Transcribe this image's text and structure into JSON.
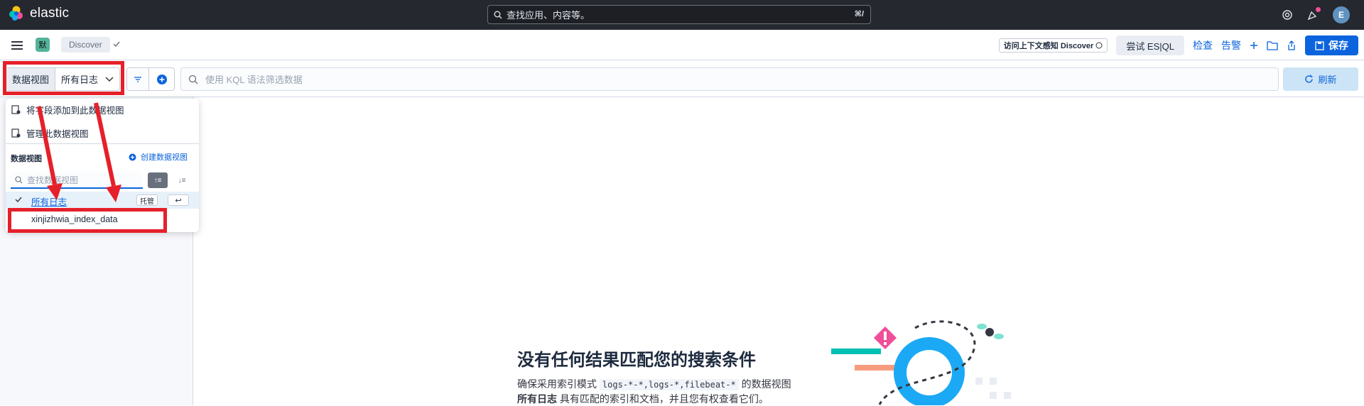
{
  "topbar": {
    "brand": "elastic",
    "search_placeholder": "查找应用、内容等。",
    "search_shortcut": "⌘/",
    "avatar_initial": "E"
  },
  "header": {
    "space_initial": "默",
    "breadcrumb": "Discover",
    "context_badge": "访问上下文感知 Discover",
    "esql_button": "尝试 ES|QL",
    "inspect_link": "检查",
    "alerts_link": "告警",
    "save_button": "保存"
  },
  "querybar": {
    "dataview_label": "数据视图",
    "dataview_selected": "所有日志",
    "kql_placeholder": "使用 KQL 语法筛选数据",
    "refresh_button": "刷新"
  },
  "popover": {
    "action_add_field": "将字段添加到此数据视图",
    "action_manage": "管理此数据视图",
    "section_title": "数据视图",
    "create_link": "创建数据视图",
    "search_placeholder": "查找数据视图",
    "sort_asc_label": "↑≡",
    "sort_desc_label": "↓≡",
    "items": [
      {
        "name": "所有日志",
        "badge": "托管",
        "undo": "↩",
        "selected": true
      },
      {
        "name": "xinjizhwia_index_data",
        "selected": false
      }
    ]
  },
  "empty_state": {
    "title": "没有任何结果匹配您的搜索条件",
    "desc_prefix": "确保采用索引模式",
    "pattern": "logs-*-*,logs-*,filebeat-*",
    "desc_suffix": "的数据视图",
    "dataview_name": "所有日志",
    "desc_line2": "具有匹配的索引和文档，并且您有权查看它们。"
  },
  "colors": {
    "accent": "#0b64dd",
    "annotation_red": "#e5202a",
    "topbar_bg": "#25282f"
  }
}
